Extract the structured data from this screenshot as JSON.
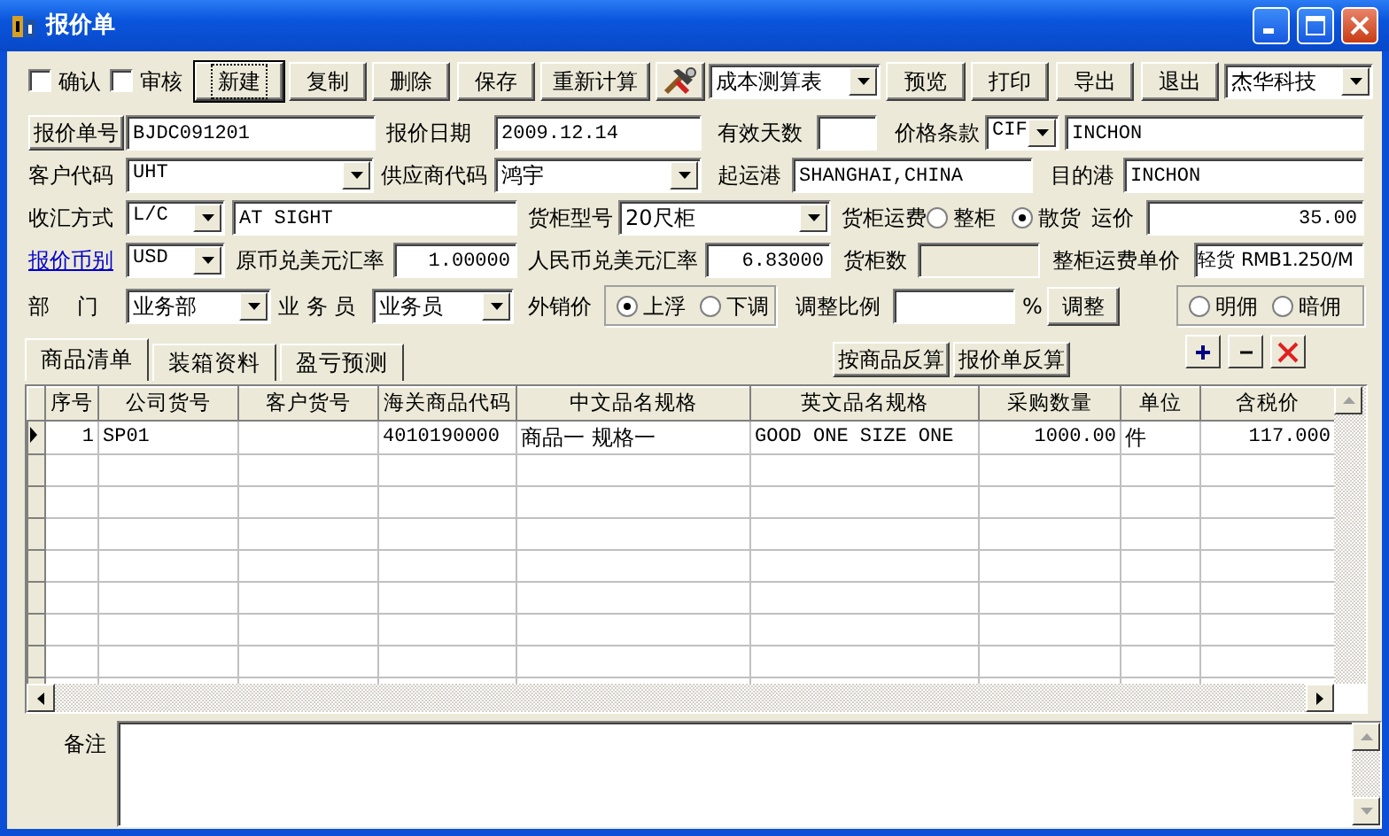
{
  "window": {
    "title": "报价单"
  },
  "toolbar": [
    {
      "kind": "checkbox",
      "label": "确认",
      "checked": false
    },
    {
      "kind": "checkbox",
      "label": "审核",
      "checked": false
    },
    {
      "kind": "button",
      "label": "新建",
      "focused": true
    },
    {
      "kind": "button",
      "label": "复制",
      "focused": false
    },
    {
      "kind": "button",
      "label": "删除",
      "focused": false
    },
    {
      "kind": "button",
      "label": "保存",
      "focused": false
    },
    {
      "kind": "button",
      "label": "重新计算",
      "focused": false
    },
    {
      "kind": "tool"
    },
    {
      "kind": "select",
      "value": "成本测算表"
    },
    {
      "kind": "button",
      "label": "预览",
      "focused": false
    },
    {
      "kind": "button",
      "label": "打印",
      "focused": false
    },
    {
      "kind": "button",
      "label": "导出",
      "focused": false
    },
    {
      "kind": "button",
      "label": "退出",
      "focused": false
    },
    {
      "kind": "select",
      "value": "杰华科技"
    }
  ],
  "form_rows": [
    [
      {
        "kind": "labelbutton",
        "label": "报价单号"
      },
      {
        "kind": "input",
        "value": "BJDC091201"
      },
      {
        "kind": "label",
        "label": "报价日期"
      },
      {
        "kind": "input",
        "value": "2009.12.14"
      },
      {
        "kind": "label",
        "label": "有效天数"
      },
      {
        "kind": "input"
      },
      {
        "kind": "label",
        "label": "价格条款"
      },
      {
        "kind": "select",
        "value": "CIF"
      },
      {
        "kind": "input",
        "value": "INCHON"
      }
    ],
    [
      {
        "kind": "label",
        "label": "客户代码"
      },
      {
        "kind": "select",
        "value": "UHT"
      },
      {
        "kind": "label",
        "label": "供应商代码"
      },
      {
        "kind": "select",
        "value": "鸿宇"
      },
      {
        "kind": "label",
        "label": "起运港"
      },
      {
        "kind": "input",
        "value": "SHANGHAI,CHINA"
      },
      {
        "kind": "label",
        "label": "目的港"
      },
      {
        "kind": "input",
        "value": "INCHON"
      }
    ],
    [
      {
        "kind": "label",
        "label": "收汇方式"
      },
      {
        "kind": "select",
        "value": "L/C"
      },
      {
        "kind": "input",
        "value": "AT SIGHT"
      },
      {
        "kind": "label",
        "label": "货柜型号"
      },
      {
        "kind": "select",
        "value": "20尺柜"
      },
      {
        "kind": "label",
        "label": "货柜运费"
      },
      {
        "kind": "radio",
        "label": "整柜",
        "selected": false
      },
      {
        "kind": "radio",
        "label": "散货",
        "selected": true
      },
      {
        "kind": "label",
        "label": "运价"
      },
      {
        "kind": "number",
        "value": "35.00"
      }
    ],
    [
      {
        "kind": "link",
        "label": "报价币别"
      },
      {
        "kind": "select",
        "value": "USD"
      },
      {
        "kind": "label",
        "label": "原币兑美元汇率"
      },
      {
        "kind": "number",
        "value": "1.00000"
      },
      {
        "kind": "label",
        "label": "人民币兑美元汇率"
      },
      {
        "kind": "number",
        "value": "6.83000"
      },
      {
        "kind": "label",
        "label": "货柜数"
      },
      {
        "kind": "input",
        "disabled": true
      },
      {
        "kind": "label",
        "label": "整柜运费单价"
      },
      {
        "kind": "input",
        "value": "轻货 RMB1.250/M"
      }
    ],
    [
      {
        "kind": "label",
        "label": "部    门"
      },
      {
        "kind": "select",
        "value": "业务部"
      },
      {
        "kind": "label",
        "label": "业 务 员"
      },
      {
        "kind": "select",
        "value": "业务员"
      },
      {
        "kind": "label",
        "label": "外销价"
      },
      {
        "kind": "radiogroup",
        "options": [
          {
            "label": "上浮",
            "selected": true
          },
          {
            "label": "下调",
            "selected": false
          }
        ]
      },
      {
        "kind": "label",
        "label": "调整比例"
      },
      {
        "kind": "input"
      },
      {
        "kind": "label",
        "label": "%"
      },
      {
        "kind": "button",
        "label": "调整"
      },
      {
        "kind": "radiogroup",
        "options": [
          {
            "label": "明佣",
            "selected": false
          },
          {
            "label": "暗佣",
            "selected": false
          }
        ]
      }
    ]
  ],
  "tabs": [
    {
      "label": "商品清单",
      "selected": true
    },
    {
      "label": "装箱资料",
      "selected": false
    },
    {
      "label": "盈亏预测",
      "selected": false
    }
  ],
  "tab_buttons": [
    "按商品反算",
    "报价单反算"
  ],
  "grid": {
    "columns": [
      "序号",
      "公司货号",
      "客户货号",
      "海关商品代码",
      "中文品名规格",
      "英文品名规格",
      "采购数量",
      "单位",
      "含税价"
    ],
    "rows": [
      {
        "selected": true,
        "cells": [
          "1",
          "SP01",
          "",
          "4010190000",
          "商品一 规格一",
          "GOOD ONE SIZE ONE",
          "1000.00",
          "件",
          "117.000"
        ]
      }
    ]
  },
  "remarks": {
    "label": "备注"
  }
}
